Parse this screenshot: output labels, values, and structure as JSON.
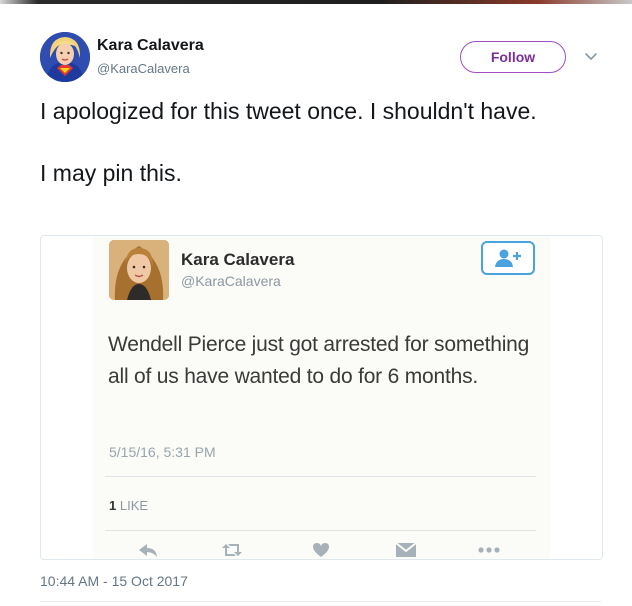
{
  "author": {
    "name": "Kara Calavera",
    "handle": "@KaraCalavera",
    "follow_label": "Follow",
    "avatar_icon": "supergirl-avatar-icon",
    "menu_icon": "chevron-down-icon"
  },
  "tweet": {
    "paragraphs": [
      "I apologized for this tweet once. I shouldn't have.",
      "I may pin this."
    ],
    "timestamp": "10:44 AM - 15 Oct 2017"
  },
  "embedded": {
    "name": "Kara Calavera",
    "handle": "@KaraCalavera",
    "text": "Wendell Pierce just got arrested for something all of us have wanted to do for 6 months.",
    "date": "5/15/16, 5:31 PM",
    "like_count": "1",
    "like_label": "LIKE",
    "follow_icon": "add-user-icon",
    "action_icons": [
      "reply-icon",
      "retweet-icon",
      "heart-icon",
      "message-icon",
      "more-icon"
    ]
  },
  "colors": {
    "follow_border": "#9f4fc0",
    "follow_text": "#7b2f9a",
    "embedded_follow_border": "#4aa3df",
    "muted_text": "#657786"
  }
}
